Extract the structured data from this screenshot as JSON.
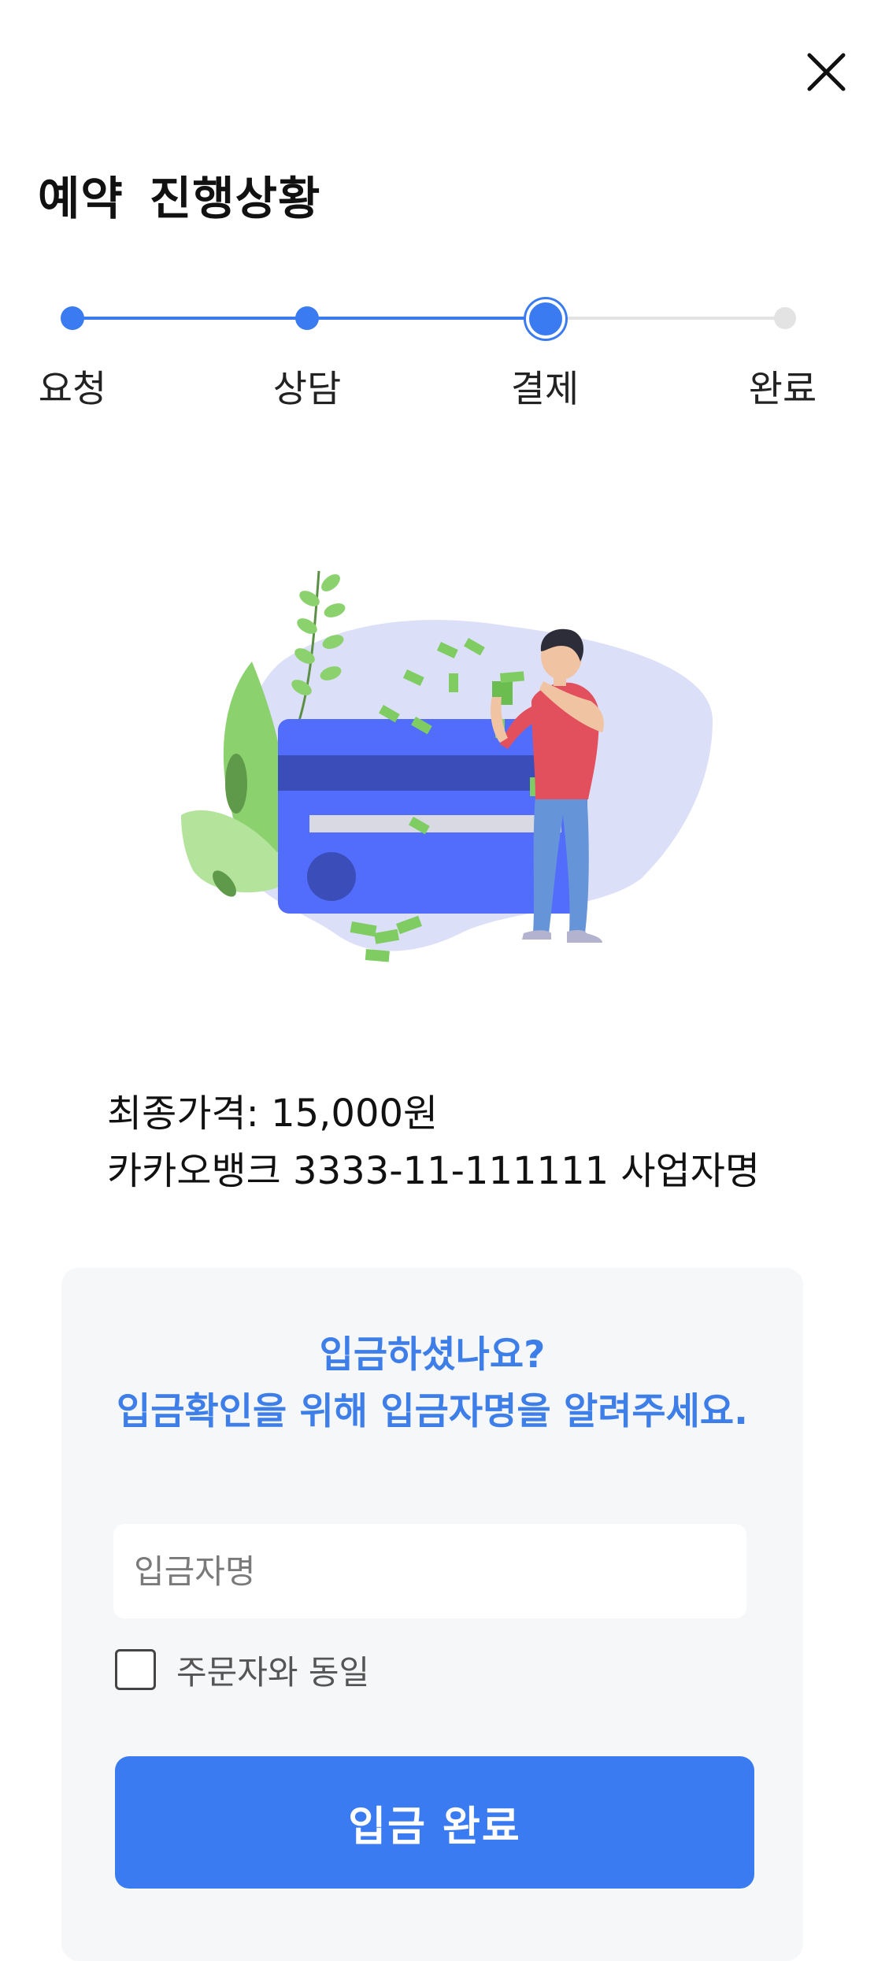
{
  "header": {
    "title": "예약 진행상황",
    "close_icon": "close-icon"
  },
  "progress": {
    "active_color": "#3b7bf2",
    "inactive_color": "#e3e3e3",
    "current_step": 3,
    "steps": [
      {
        "label": "요청",
        "state": "done"
      },
      {
        "label": "상담",
        "state": "done"
      },
      {
        "label": "결제",
        "state": "current"
      },
      {
        "label": "완료",
        "state": "pending"
      }
    ]
  },
  "illustration": {
    "icon": "payment-card-illustration"
  },
  "payment": {
    "final_price": "최종가격: 15,000원",
    "bank_account": "카카오뱅크 3333-11-111111 사업자명"
  },
  "deposit": {
    "question_line1": "입금하셨나요?",
    "question_line2": "입금확인을 위해 입금자명을 알려주세요.",
    "name_placeholder": "입금자명",
    "name_value": "",
    "same_as_orderer_label": "주문자와 동일",
    "same_as_orderer_checked": false,
    "submit_label": "입금 완료",
    "accent_color": "#3d7ee8"
  }
}
